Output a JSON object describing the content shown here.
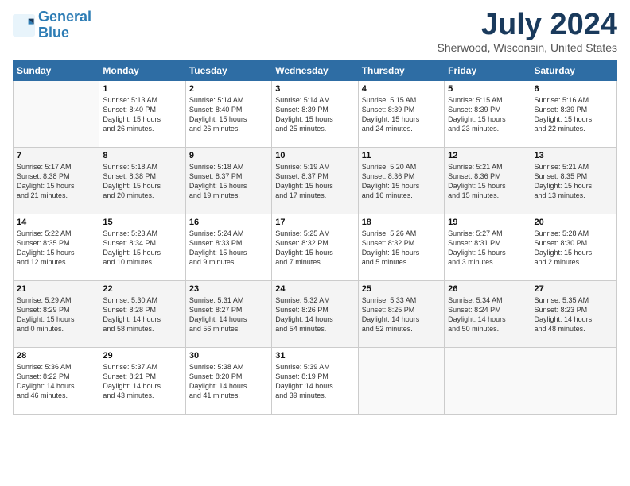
{
  "logo": {
    "line1": "General",
    "line2": "Blue"
  },
  "title": "July 2024",
  "location": "Sherwood, Wisconsin, United States",
  "weekdays": [
    "Sunday",
    "Monday",
    "Tuesday",
    "Wednesday",
    "Thursday",
    "Friday",
    "Saturday"
  ],
  "weeks": [
    [
      {
        "day": "",
        "content": ""
      },
      {
        "day": "1",
        "content": "Sunrise: 5:13 AM\nSunset: 8:40 PM\nDaylight: 15 hours\nand 26 minutes."
      },
      {
        "day": "2",
        "content": "Sunrise: 5:14 AM\nSunset: 8:40 PM\nDaylight: 15 hours\nand 26 minutes."
      },
      {
        "day": "3",
        "content": "Sunrise: 5:14 AM\nSunset: 8:39 PM\nDaylight: 15 hours\nand 25 minutes."
      },
      {
        "day": "4",
        "content": "Sunrise: 5:15 AM\nSunset: 8:39 PM\nDaylight: 15 hours\nand 24 minutes."
      },
      {
        "day": "5",
        "content": "Sunrise: 5:15 AM\nSunset: 8:39 PM\nDaylight: 15 hours\nand 23 minutes."
      },
      {
        "day": "6",
        "content": "Sunrise: 5:16 AM\nSunset: 8:39 PM\nDaylight: 15 hours\nand 22 minutes."
      }
    ],
    [
      {
        "day": "7",
        "content": "Sunrise: 5:17 AM\nSunset: 8:38 PM\nDaylight: 15 hours\nand 21 minutes."
      },
      {
        "day": "8",
        "content": "Sunrise: 5:18 AM\nSunset: 8:38 PM\nDaylight: 15 hours\nand 20 minutes."
      },
      {
        "day": "9",
        "content": "Sunrise: 5:18 AM\nSunset: 8:37 PM\nDaylight: 15 hours\nand 19 minutes."
      },
      {
        "day": "10",
        "content": "Sunrise: 5:19 AM\nSunset: 8:37 PM\nDaylight: 15 hours\nand 17 minutes."
      },
      {
        "day": "11",
        "content": "Sunrise: 5:20 AM\nSunset: 8:36 PM\nDaylight: 15 hours\nand 16 minutes."
      },
      {
        "day": "12",
        "content": "Sunrise: 5:21 AM\nSunset: 8:36 PM\nDaylight: 15 hours\nand 15 minutes."
      },
      {
        "day": "13",
        "content": "Sunrise: 5:21 AM\nSunset: 8:35 PM\nDaylight: 15 hours\nand 13 minutes."
      }
    ],
    [
      {
        "day": "14",
        "content": "Sunrise: 5:22 AM\nSunset: 8:35 PM\nDaylight: 15 hours\nand 12 minutes."
      },
      {
        "day": "15",
        "content": "Sunrise: 5:23 AM\nSunset: 8:34 PM\nDaylight: 15 hours\nand 10 minutes."
      },
      {
        "day": "16",
        "content": "Sunrise: 5:24 AM\nSunset: 8:33 PM\nDaylight: 15 hours\nand 9 minutes."
      },
      {
        "day": "17",
        "content": "Sunrise: 5:25 AM\nSunset: 8:32 PM\nDaylight: 15 hours\nand 7 minutes."
      },
      {
        "day": "18",
        "content": "Sunrise: 5:26 AM\nSunset: 8:32 PM\nDaylight: 15 hours\nand 5 minutes."
      },
      {
        "day": "19",
        "content": "Sunrise: 5:27 AM\nSunset: 8:31 PM\nDaylight: 15 hours\nand 3 minutes."
      },
      {
        "day": "20",
        "content": "Sunrise: 5:28 AM\nSunset: 8:30 PM\nDaylight: 15 hours\nand 2 minutes."
      }
    ],
    [
      {
        "day": "21",
        "content": "Sunrise: 5:29 AM\nSunset: 8:29 PM\nDaylight: 15 hours\nand 0 minutes."
      },
      {
        "day": "22",
        "content": "Sunrise: 5:30 AM\nSunset: 8:28 PM\nDaylight: 14 hours\nand 58 minutes."
      },
      {
        "day": "23",
        "content": "Sunrise: 5:31 AM\nSunset: 8:27 PM\nDaylight: 14 hours\nand 56 minutes."
      },
      {
        "day": "24",
        "content": "Sunrise: 5:32 AM\nSunset: 8:26 PM\nDaylight: 14 hours\nand 54 minutes."
      },
      {
        "day": "25",
        "content": "Sunrise: 5:33 AM\nSunset: 8:25 PM\nDaylight: 14 hours\nand 52 minutes."
      },
      {
        "day": "26",
        "content": "Sunrise: 5:34 AM\nSunset: 8:24 PM\nDaylight: 14 hours\nand 50 minutes."
      },
      {
        "day": "27",
        "content": "Sunrise: 5:35 AM\nSunset: 8:23 PM\nDaylight: 14 hours\nand 48 minutes."
      }
    ],
    [
      {
        "day": "28",
        "content": "Sunrise: 5:36 AM\nSunset: 8:22 PM\nDaylight: 14 hours\nand 46 minutes."
      },
      {
        "day": "29",
        "content": "Sunrise: 5:37 AM\nSunset: 8:21 PM\nDaylight: 14 hours\nand 43 minutes."
      },
      {
        "day": "30",
        "content": "Sunrise: 5:38 AM\nSunset: 8:20 PM\nDaylight: 14 hours\nand 41 minutes."
      },
      {
        "day": "31",
        "content": "Sunrise: 5:39 AM\nSunset: 8:19 PM\nDaylight: 14 hours\nand 39 minutes."
      },
      {
        "day": "",
        "content": ""
      },
      {
        "day": "",
        "content": ""
      },
      {
        "day": "",
        "content": ""
      }
    ]
  ]
}
